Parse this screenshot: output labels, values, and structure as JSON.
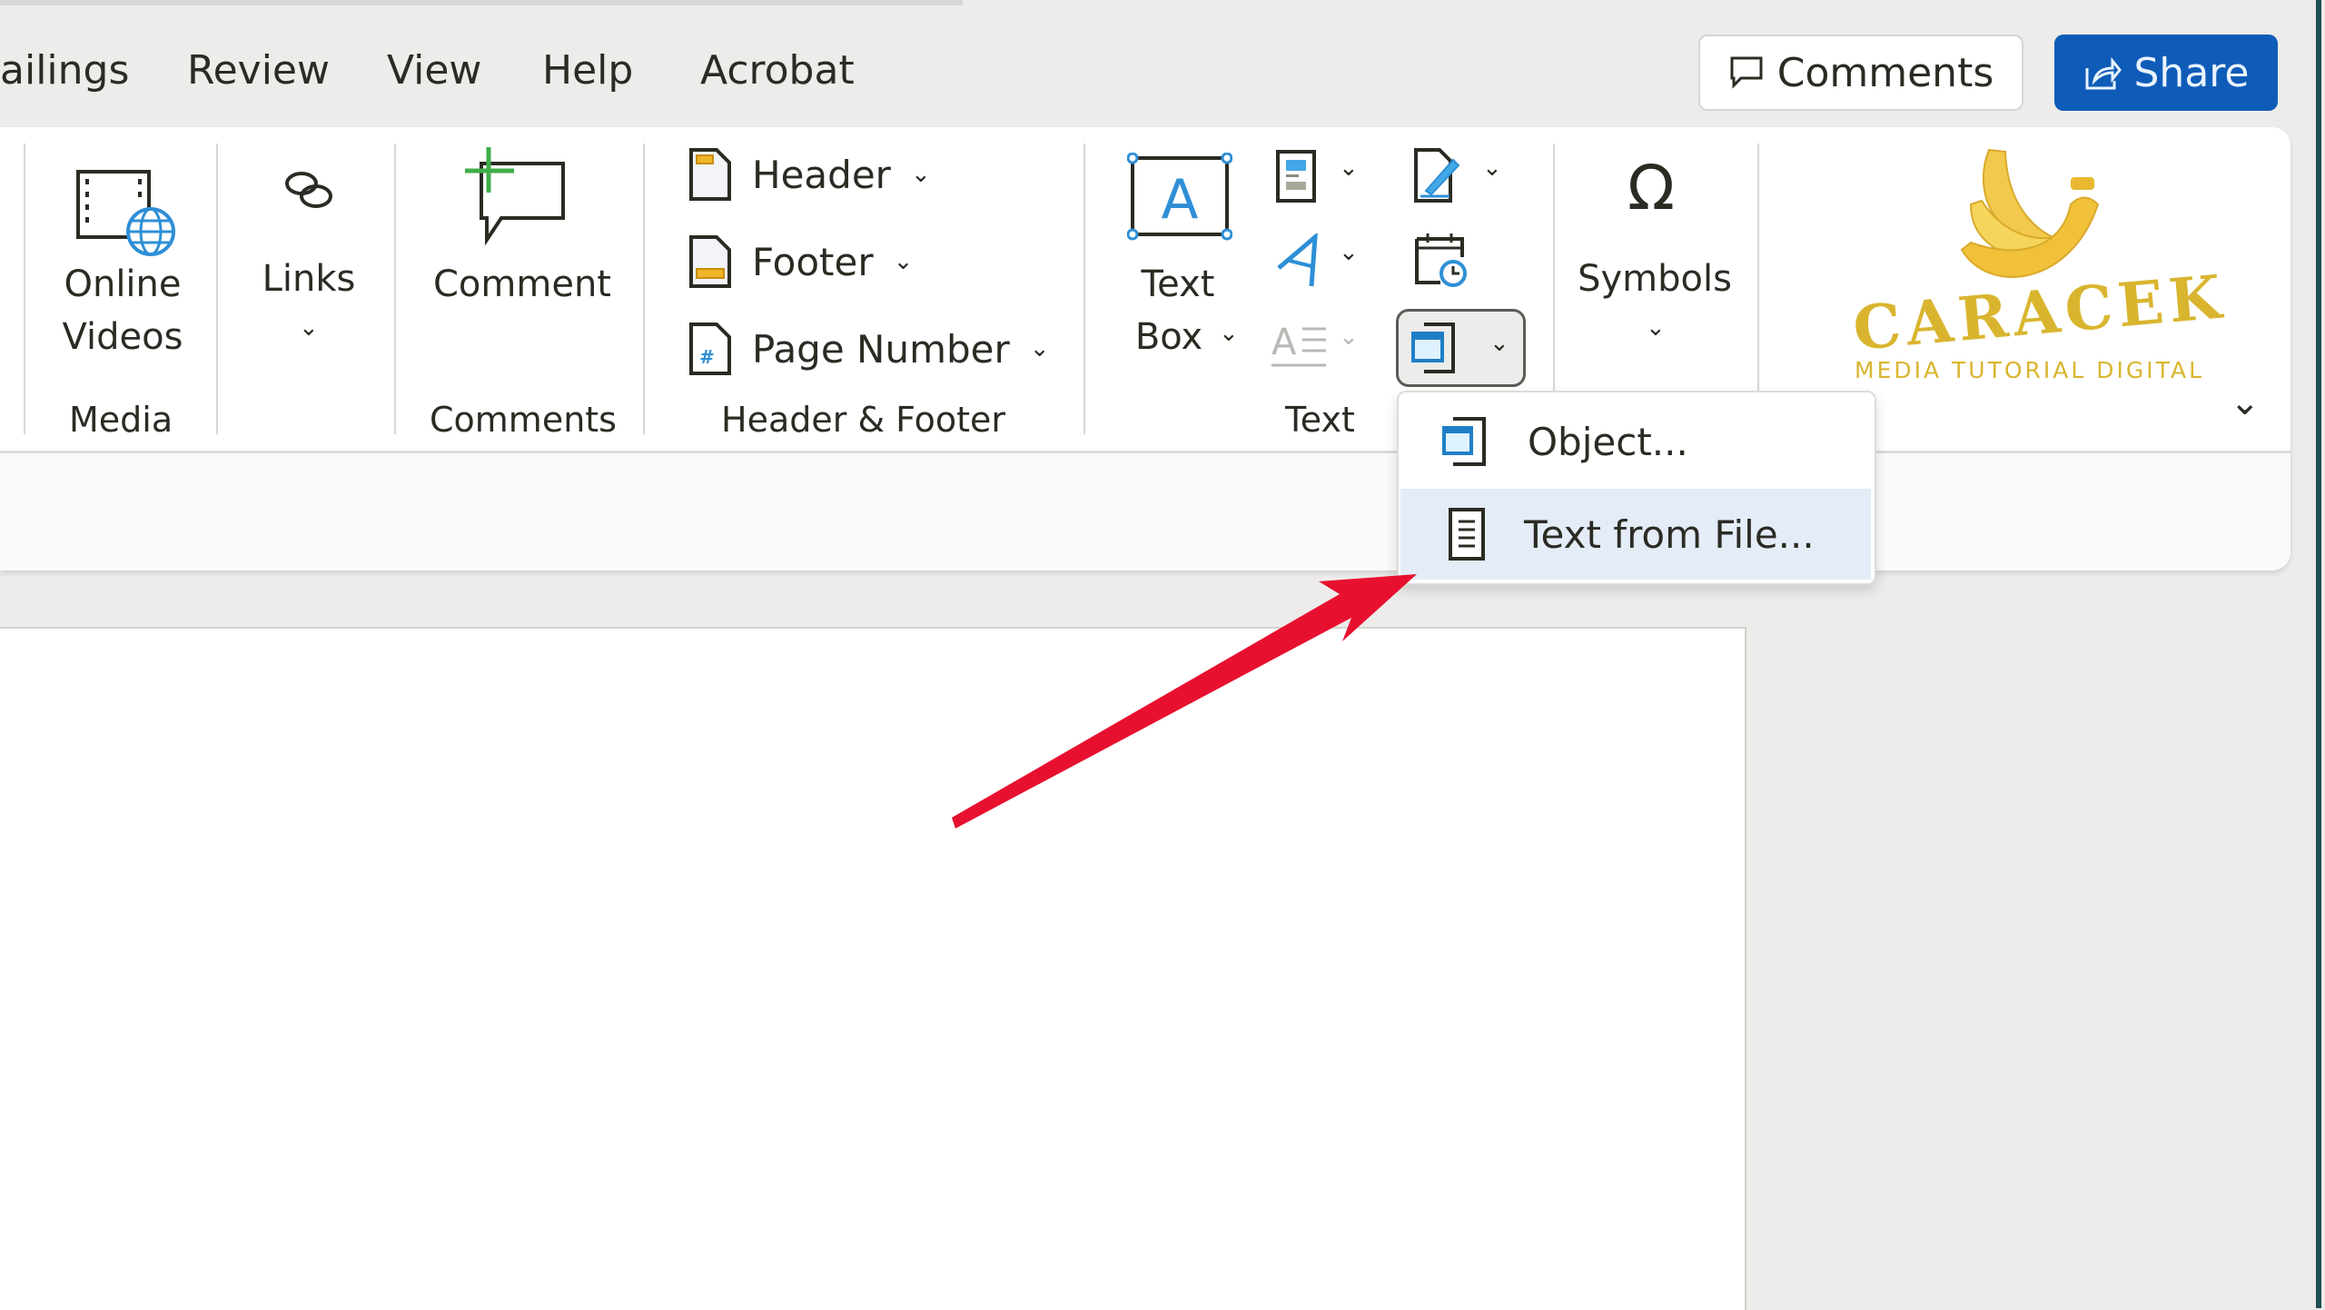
{
  "tabs": [
    "ailings",
    "Review",
    "View",
    "Help",
    "Acrobat"
  ],
  "top_buttons": {
    "comments": "Comments",
    "share": "Share"
  },
  "colors": {
    "share_bg": "#0f5cb8",
    "accent_blue": "#2e8fd6",
    "arrow_red": "#e8102f",
    "logo_gold": "#d9b52f",
    "menu_hover": "#e4ecf7"
  },
  "groups": {
    "media": {
      "label": "Media",
      "online_videos": [
        "Online",
        "Videos"
      ]
    },
    "links": {
      "label": "Links"
    },
    "comments": {
      "label": "Comments",
      "comment": "Comment"
    },
    "header_footer": {
      "label": "Header & Footer",
      "header": "Header",
      "footer": "Footer",
      "page_number": "Page Number"
    },
    "text": {
      "label": "Text",
      "text_box": [
        "Text",
        "Box"
      ]
    },
    "symbols": {
      "label": "Symbols"
    }
  },
  "object_menu": {
    "items": [
      "Object...",
      "Text from File..."
    ],
    "highlighted": "Text from File..."
  },
  "watermark": {
    "brand": "CARACEK",
    "tagline": "MEDIA TUTORIAL DIGITAL"
  }
}
